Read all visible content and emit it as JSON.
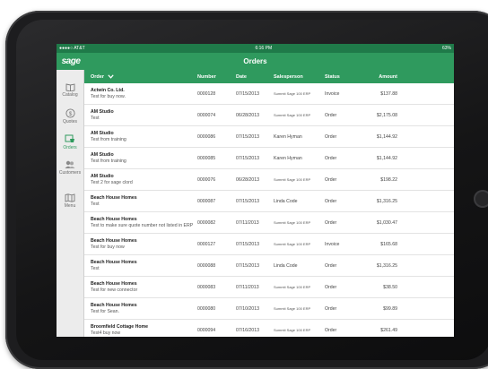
{
  "status_bar": {
    "carrier": "●●●●○ AT&T",
    "time": "6:16 PM",
    "battery": "63%"
  },
  "nav": {
    "brand": "sage",
    "title": "Orders"
  },
  "sidebar": {
    "items": [
      {
        "label": "Catalog",
        "icon": "book-icon"
      },
      {
        "label": "Quotes",
        "icon": "dollar-circle-icon"
      },
      {
        "label": "Orders",
        "icon": "cart-icon",
        "active": true
      },
      {
        "label": "Customers",
        "icon": "people-icon"
      },
      {
        "label": "Menu",
        "icon": "map-icon"
      }
    ]
  },
  "table": {
    "headers": {
      "order": "Order",
      "number": "Number",
      "date": "Date",
      "salesperson": "Salesperson",
      "status": "Status",
      "amount": "Amount"
    },
    "rows": [
      {
        "customer": "Actwin Co. Ltd.",
        "note": "Test for buy now.",
        "number": "0000128",
        "date": "07/15/2013",
        "salesperson": "Summit Sage 100 ERP",
        "status": "Invoice",
        "amount": "$137.88"
      },
      {
        "customer": "AM Studio",
        "note": "Test",
        "number": "0000074",
        "date": "06/28/2013",
        "salesperson": "Summit Sage 100 ERP",
        "status": "Order",
        "amount": "$2,175.08"
      },
      {
        "customer": "AM Studio",
        "note": "Test from training",
        "number": "0000086",
        "date": "07/15/2013",
        "salesperson": "Karen Hyman",
        "status": "Order",
        "amount": "$1,144.92"
      },
      {
        "customer": "AM Studio",
        "note": "Test from training",
        "number": "0000085",
        "date": "07/15/2013",
        "salesperson": "Karen Hyman",
        "status": "Order",
        "amount": "$1,144.92"
      },
      {
        "customer": "AM Studio",
        "note": "Test 2 for sage clord",
        "number": "0000076",
        "date": "06/28/2013",
        "salesperson": "Summit Sage 100 ERP",
        "status": "Order",
        "amount": "$198.22"
      },
      {
        "customer": "Beach House Homes",
        "note": "Test",
        "number": "0000087",
        "date": "07/15/2013",
        "salesperson": "Linda Code",
        "status": "Order",
        "amount": "$1,316.25"
      },
      {
        "customer": "Beach House Homes",
        "note": "Test to make sure quote number not listed in ERP",
        "number": "0000082",
        "date": "07/11/2013",
        "salesperson": "Summit Sage 100 ERP",
        "status": "Order",
        "amount": "$1,030.47"
      },
      {
        "customer": "Beach House Homes",
        "note": "Test for buy now",
        "number": "0000127",
        "date": "07/15/2013",
        "salesperson": "Summit Sage 100 ERP",
        "status": "Invoice",
        "amount": "$165.68"
      },
      {
        "customer": "Beach House Homes",
        "note": "Test",
        "number": "0000088",
        "date": "07/15/2013",
        "salesperson": "Linda Code",
        "status": "Order",
        "amount": "$1,316.25"
      },
      {
        "customer": "Beach House Homes",
        "note": "Test for new connector",
        "number": "0000083",
        "date": "07/11/2013",
        "salesperson": "Summit Sage 100 ERP",
        "status": "Order",
        "amount": "$38.50"
      },
      {
        "customer": "Beach House Homes",
        "note": "Test for Sean.",
        "number": "0000080",
        "date": "07/10/2013",
        "salesperson": "Summit Sage 100 ERP",
        "status": "Order",
        "amount": "$99.89"
      },
      {
        "customer": "Broomfield Cottage Home",
        "note": "Test4 buy now",
        "number": "0000094",
        "date": "07/16/2013",
        "salesperson": "Summit Sage 100 ERP",
        "status": "Order",
        "amount": "$261.49"
      }
    ]
  },
  "colors": {
    "accent": "#2f9a5e",
    "statusbar": "#1f7a49"
  }
}
